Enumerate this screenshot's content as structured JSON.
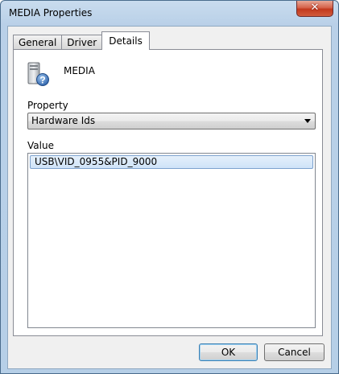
{
  "window": {
    "title": "MEDIA Properties",
    "close_glyph": "✕"
  },
  "tabs": [
    {
      "label": "General",
      "active": false
    },
    {
      "label": "Driver",
      "active": false
    },
    {
      "label": "Details",
      "active": true
    }
  ],
  "device": {
    "name": "MEDIA",
    "icon": "unknown-device-icon"
  },
  "property": {
    "label": "Property",
    "selected": "Hardware Ids"
  },
  "value": {
    "label": "Value",
    "items": [
      "USB\\VID_0955&PID_9000"
    ]
  },
  "buttons": {
    "ok": "OK",
    "cancel": "Cancel"
  },
  "colors": {
    "selection_border": "#7da2ce",
    "close_button": "#c2391d",
    "title_gradient": "#b9d0e8"
  }
}
